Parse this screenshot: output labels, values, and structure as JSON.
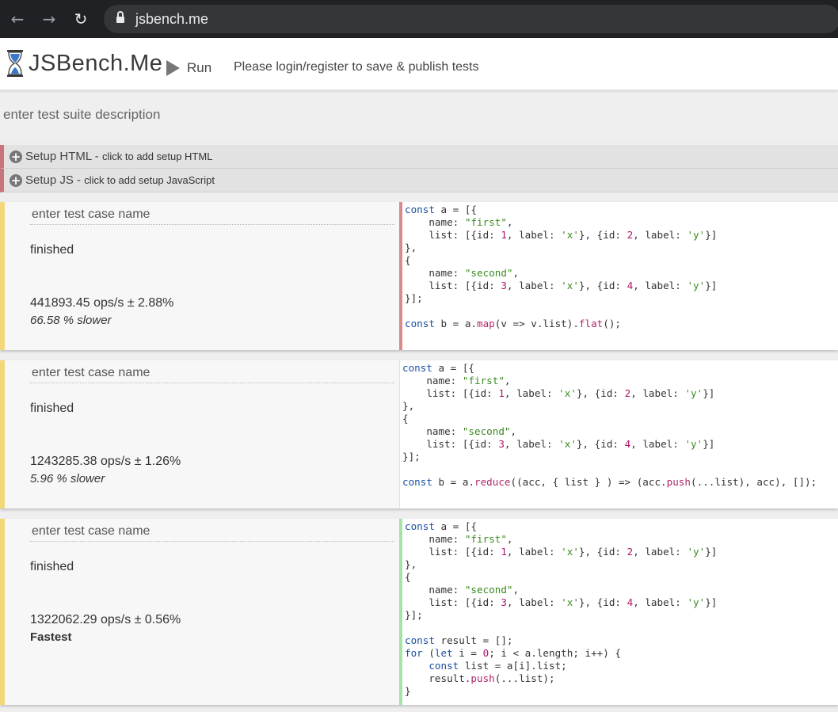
{
  "browser": {
    "url": "jsbench.me",
    "back_icon": "←",
    "forward_icon": "→",
    "reload_icon": "↻"
  },
  "header": {
    "logo_text": "JSBench.Me",
    "run_label": "Run",
    "login_message": "Please login/register to save & publish tests"
  },
  "suite": {
    "description_placeholder": "enter test suite description"
  },
  "setup": {
    "html_title": "Setup HTML - ",
    "html_hint": "click to add setup HTML",
    "js_title": "Setup JS - ",
    "js_hint": "click to add setup JavaScript"
  },
  "tests": [
    {
      "name_placeholder": "enter test case name",
      "status": "finished",
      "ops": "441893.45 ops/s ± 2.88%",
      "relative": "66.58 % slower"
    },
    {
      "name_placeholder": "enter test case name",
      "status": "finished",
      "ops": "1243285.38 ops/s ± 1.26%",
      "relative": "5.96 % slower"
    },
    {
      "name_placeholder": "enter test case name",
      "status": "finished",
      "ops": "1322062.29 ops/s ± 0.56%",
      "relative": "Fastest"
    }
  ],
  "colors": {
    "slow_border": "#d98a8a",
    "fast_border": "#a6e3a6",
    "card_accent": "#f2d87a",
    "setup_accent": "#c9737b"
  }
}
